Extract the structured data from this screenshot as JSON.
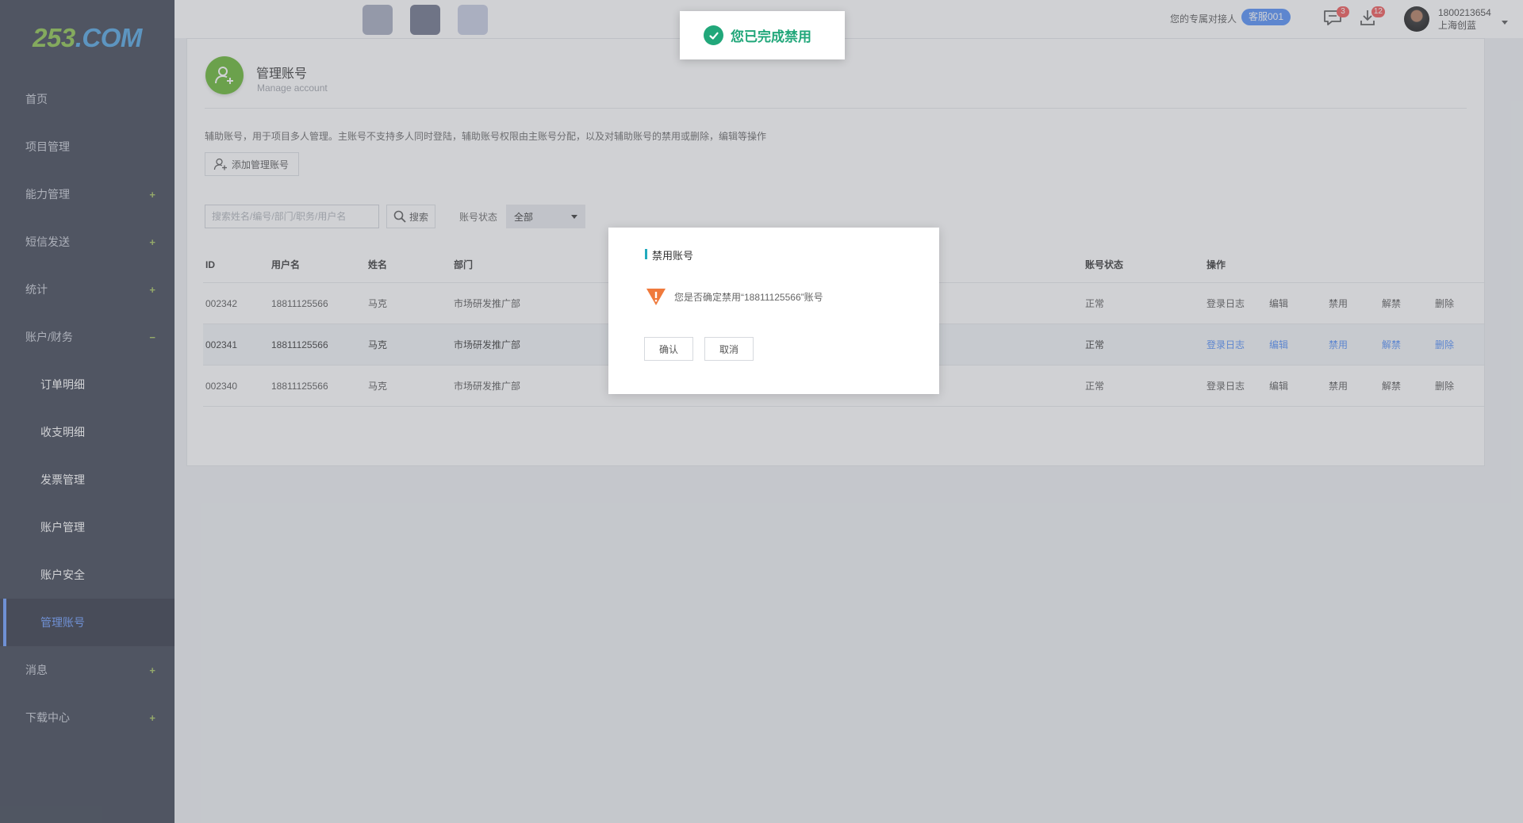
{
  "logo": {
    "num": "253",
    "domain": ".COM"
  },
  "sidebar": {
    "items": [
      {
        "label": "首页",
        "toggle": ""
      },
      {
        "label": "项目管理",
        "toggle": ""
      },
      {
        "label": "能力管理",
        "toggle": "+"
      },
      {
        "label": "短信发送",
        "toggle": "+"
      },
      {
        "label": "统计",
        "toggle": "+"
      },
      {
        "label": "账户/财务",
        "toggle": "−"
      },
      {
        "label": "订单明细"
      },
      {
        "label": "收支明细"
      },
      {
        "label": "发票管理"
      },
      {
        "label": "账户管理"
      },
      {
        "label": "账户安全"
      },
      {
        "label": "管理账号"
      },
      {
        "label": "消息",
        "toggle": "+"
      },
      {
        "label": "下载中心",
        "toggle": "+"
      }
    ]
  },
  "topbar": {
    "swatches": [
      "#a3a9bd",
      "#6b7088",
      "#c5cbe0"
    ],
    "contact_label": "您的专属对接人",
    "contact_name": "客服001",
    "messages_count": "3",
    "downloads_count": "12",
    "user_phone": "1800213654",
    "user_company": "上海创蓝"
  },
  "page": {
    "title": "管理账号",
    "subtitle": "Manage account",
    "description": "辅助账号，用于项目多人管理。主账号不支持多人同时登陆，辅助账号权限由主账号分配，以及对辅助账号的禁用或删除，编辑等操作",
    "add_button": "添加管理账号",
    "search_placeholder": "搜索姓名/编号/部门/职务/用户名",
    "search_button": "搜索",
    "status_label": "账号状态",
    "status_value": "全部"
  },
  "table": {
    "headers": {
      "id": "ID",
      "username": "用户名",
      "name": "姓名",
      "dept": "部门",
      "status": "账号状态",
      "ops": "操作"
    },
    "rows": [
      {
        "id": "002342",
        "username": "18811125566",
        "name": "马克",
        "dept": "市场研发推广部",
        "status": "正常"
      },
      {
        "id": "002341",
        "username": "18811125566",
        "name": "马克",
        "dept": "市场研发推广部",
        "status": "正常"
      },
      {
        "id": "002340",
        "username": "18811125566",
        "name": "马克",
        "dept": "市场研发推广部",
        "status": "正常"
      }
    ],
    "actions": {
      "log": "登录日志",
      "edit": "编辑",
      "disable": "禁用",
      "enable": "解禁",
      "delete": "删除"
    }
  },
  "toast": {
    "text": "您已完成禁用"
  },
  "modal": {
    "title": "禁用账号",
    "message": "您是否确定禁用“18811125566”账号",
    "confirm": "确认",
    "cancel": "取消"
  },
  "colors": {
    "accent": "#4f8cf7",
    "success": "#21a77a",
    "sidebar": "#3b4150",
    "brand_green": "#65b52e"
  }
}
